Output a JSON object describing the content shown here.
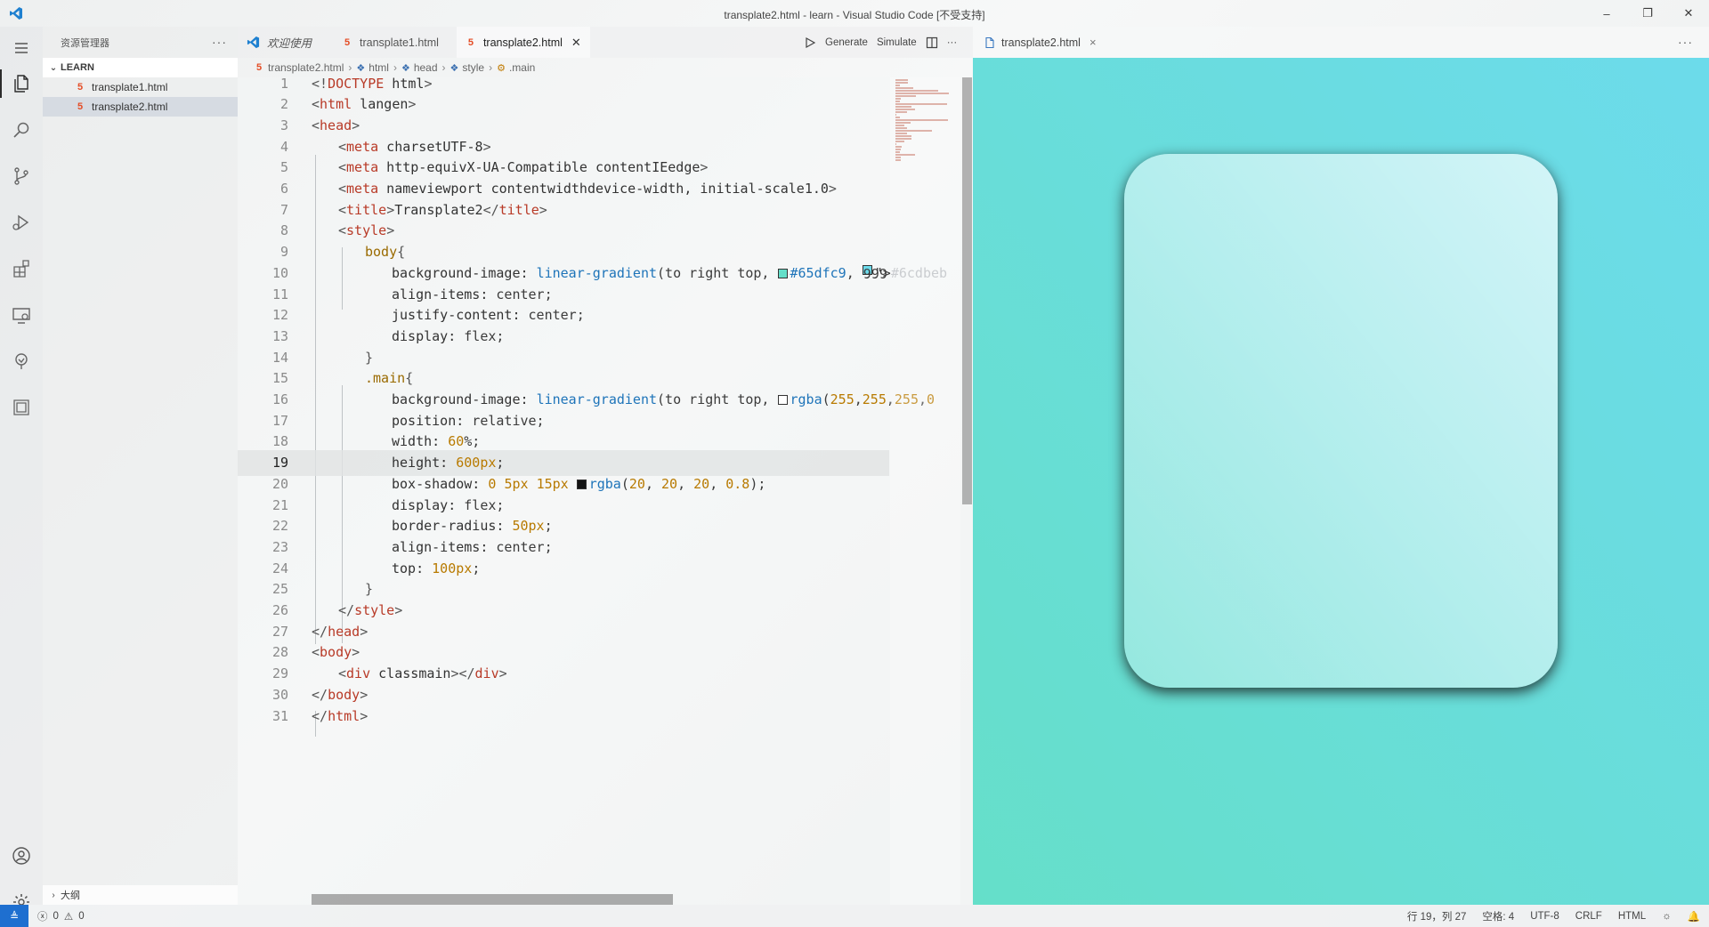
{
  "window": {
    "title": "transplate2.html - learn - Visual Studio Code [不受支持]",
    "minimize": "–",
    "restore": "❐",
    "close": "✕"
  },
  "activity_bar": [
    "menu-icon",
    "explorer-icon",
    "search-icon",
    "source-control-icon",
    "run-debug-icon",
    "extensions-icon",
    "remote-explorer-icon",
    "tree-icon",
    "panel-icon",
    "account-icon",
    "settings-icon"
  ],
  "sidebar": {
    "header": "资源管理器",
    "more": "···",
    "folder": "LEARN",
    "files": [
      {
        "name": "transplate1.html"
      },
      {
        "name": "transplate2.html"
      }
    ],
    "outline": "大纲"
  },
  "tabs": [
    {
      "label": "欢迎使用"
    },
    {
      "label": "transplate1.html"
    },
    {
      "label": "transplate2.html"
    }
  ],
  "tab_actions": {
    "generate": "Generate",
    "simulate": "Simulate",
    "more": "···"
  },
  "breadcrumb": [
    "transplate2.html",
    "html",
    "head",
    "style",
    ".main"
  ],
  "code": {
    "current_line": 19,
    "line_numbers": [
      "1",
      "2",
      "3",
      "4",
      "5",
      "6",
      "7",
      "8",
      "9",
      "10",
      "11",
      "12",
      "13",
      "14",
      "15",
      "16",
      "17",
      "18",
      "19",
      "20",
      "21",
      "22",
      "23",
      "24",
      "25",
      "26",
      "27",
      "28",
      "29",
      "30",
      "31"
    ],
    "lines": [
      "<!DOCTYPE html>",
      "<html lang=\"en\">",
      "<head>",
      "<meta charset=\"UTF-8\">",
      "<meta http-equiv=\"X-UA-Compatible\" content=\"IE=edge\">",
      "<meta name=\"viewport\" content=\"width=device-width, initial-scale=1.0\">",
      "<title>Transplate2</title>",
      "<style>",
      "body{",
      "background-image: linear-gradient(to right top, #65dfc9, #6cdbeb",
      "align-items: center;",
      "justify-content: center;",
      "display: flex;",
      "}",
      ".main{",
      "background-image: linear-gradient(to right top, rgba(255,255,255,0",
      "position: relative;",
      "width: 60%;",
      "height: 600px;",
      "box-shadow: 0 5px 15px rgba(20, 20, 20, 0.8);",
      "display: flex;",
      "border-radius: 50px;",
      "align-items: center;",
      "top: 100px;",
      "}",
      "</style>",
      "</head>",
      "<body>",
      "<div class=\"main\"></div>",
      "</body>",
      "</html>"
    ]
  },
  "preview": {
    "tab_label": "transplate2.html",
    "close": "×",
    "more": "···",
    "gradient_start": "#65dfc9",
    "gradient_end": "#6cdbeb"
  },
  "statusbar": {
    "errors": "0",
    "warnings": "0",
    "position": "行 19，列 27",
    "spaces": "空格: 4",
    "encoding": "UTF-8",
    "eol": "CRLF",
    "language": "HTML"
  },
  "colors": {
    "accent": "#1e6fd0",
    "html_icon": "#e44d26"
  }
}
